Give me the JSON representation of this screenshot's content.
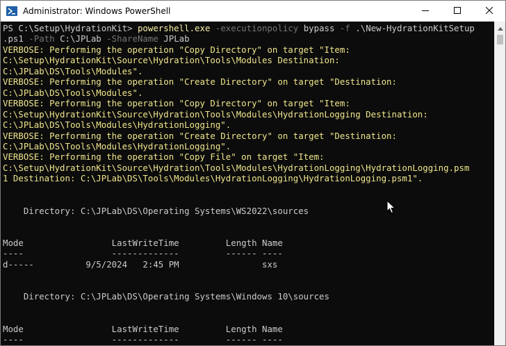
{
  "window": {
    "title": "Administrator: Windows PowerShell",
    "icon": "powershell-icon",
    "controls": [
      "minimize-icon",
      "maximize-icon",
      "close-icon"
    ]
  },
  "terminal": {
    "lines": [
      {
        "segments": [
          {
            "t": "PS C:\\Setup\\HydrationKit> ",
            "c": "white"
          },
          {
            "t": "powershell.exe",
            "c": "yellow"
          },
          {
            "t": " -executionpolicy",
            "c": "gray"
          },
          {
            "t": " bypass",
            "c": "white"
          },
          {
            "t": " -f",
            "c": "gray"
          },
          {
            "t": " .\\New-HydrationKitSetup",
            "c": "white"
          }
        ]
      },
      {
        "segments": [
          {
            "t": ".ps1",
            "c": "white"
          },
          {
            "t": " -Path",
            "c": "gray"
          },
          {
            "t": " C:\\JPLab",
            "c": "white"
          },
          {
            "t": " -ShareName",
            "c": "gray"
          },
          {
            "t": " JPLab",
            "c": "white"
          }
        ]
      },
      {
        "segments": [
          {
            "t": "VERBOSE: Performing the operation \"Copy Directory\" on target \"Item:",
            "c": "verbose"
          }
        ]
      },
      {
        "segments": [
          {
            "t": "C:\\Setup\\HydrationKit\\Source\\Hydration\\Tools\\Modules Destination:",
            "c": "verbose"
          }
        ]
      },
      {
        "segments": [
          {
            "t": "C:\\JPLab\\DS\\Tools\\Modules\".",
            "c": "verbose"
          }
        ]
      },
      {
        "segments": [
          {
            "t": "VERBOSE: Performing the operation \"Create Directory\" on target \"Destination:",
            "c": "verbose"
          }
        ]
      },
      {
        "segments": [
          {
            "t": "C:\\JPLab\\DS\\Tools\\Modules\".",
            "c": "verbose"
          }
        ]
      },
      {
        "segments": [
          {
            "t": "VERBOSE: Performing the operation \"Copy Directory\" on target \"Item:",
            "c": "verbose"
          }
        ]
      },
      {
        "segments": [
          {
            "t": "C:\\Setup\\HydrationKit\\Source\\Hydration\\Tools\\Modules\\HydrationLogging Destination:",
            "c": "verbose"
          }
        ]
      },
      {
        "segments": [
          {
            "t": "C:\\JPLab\\DS\\Tools\\Modules\\HydrationLogging\".",
            "c": "verbose"
          }
        ]
      },
      {
        "segments": [
          {
            "t": "VERBOSE: Performing the operation \"Create Directory\" on target \"Destination:",
            "c": "verbose"
          }
        ]
      },
      {
        "segments": [
          {
            "t": "C:\\JPLab\\DS\\Tools\\Modules\\HydrationLogging\".",
            "c": "verbose"
          }
        ]
      },
      {
        "segments": [
          {
            "t": "VERBOSE: Performing the operation \"Copy File\" on target \"Item:",
            "c": "verbose"
          }
        ]
      },
      {
        "segments": [
          {
            "t": "C:\\Setup\\HydrationKit\\Source\\Hydration\\Tools\\Modules\\HydrationLogging\\HydrationLogging.psm",
            "c": "verbose"
          }
        ]
      },
      {
        "segments": [
          {
            "t": "1 Destination: C:\\JPLab\\DS\\Tools\\Modules\\HydrationLogging\\HydrationLogging.psm1\".",
            "c": "verbose"
          }
        ]
      },
      {
        "segments": [
          {
            "t": "",
            "c": "white"
          }
        ]
      },
      {
        "segments": [
          {
            "t": "",
            "c": "white"
          }
        ]
      },
      {
        "segments": [
          {
            "t": "    Directory: C:\\JPLab\\DS\\Operating Systems\\WS2022\\sources",
            "c": "white"
          }
        ]
      },
      {
        "segments": [
          {
            "t": "",
            "c": "white"
          }
        ]
      },
      {
        "segments": [
          {
            "t": "",
            "c": "white"
          }
        ]
      },
      {
        "segments": [
          {
            "t": "Mode                 LastWriteTime         Length Name",
            "c": "white"
          }
        ]
      },
      {
        "segments": [
          {
            "t": "----                 -------------         ------ ----",
            "c": "white"
          }
        ]
      },
      {
        "segments": [
          {
            "t": "d-----          9/5/2024   2:45 PM                sxs",
            "c": "white"
          }
        ]
      },
      {
        "segments": [
          {
            "t": "",
            "c": "white"
          }
        ]
      },
      {
        "segments": [
          {
            "t": "",
            "c": "white"
          }
        ]
      },
      {
        "segments": [
          {
            "t": "    Directory: C:\\JPLab\\DS\\Operating Systems\\Windows 10\\sources",
            "c": "white"
          }
        ]
      },
      {
        "segments": [
          {
            "t": "",
            "c": "white"
          }
        ]
      },
      {
        "segments": [
          {
            "t": "",
            "c": "white"
          }
        ]
      },
      {
        "segments": [
          {
            "t": "Mode                 LastWriteTime         Length Name",
            "c": "white"
          }
        ]
      },
      {
        "segments": [
          {
            "t": "----                 -------------         ------ ----",
            "c": "white"
          }
        ]
      }
    ]
  },
  "colors": {
    "white": "#cccccc",
    "yellow": "#f9f1a5",
    "gray": "#767676",
    "verbose": "#f0e68c",
    "background": "#0c0c0c"
  }
}
